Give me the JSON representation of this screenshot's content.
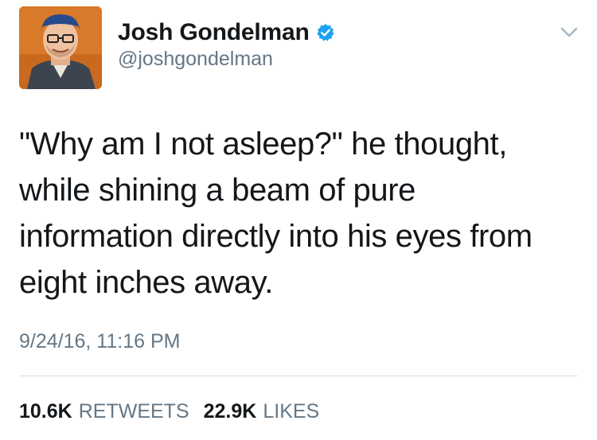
{
  "author": {
    "display_name": "Josh Gondelman",
    "handle": "@joshgondelman",
    "verified": true
  },
  "tweet": {
    "text": "\"Why am I not asleep?\" he thought, while shining a beam of pure information directly into his eyes from eight inches away.",
    "timestamp": "9/24/16, 11:16 PM"
  },
  "stats": {
    "retweets_count": "10.6K",
    "retweets_label": "RETWEETS",
    "likes_count": "22.9K",
    "likes_label": "LIKES"
  },
  "icons": {
    "verified": "verified-badge-icon",
    "menu": "chevron-down-icon"
  },
  "colors": {
    "verified_blue": "#1da1f2",
    "secondary_text": "#657786",
    "divider": "#d8dde1"
  }
}
